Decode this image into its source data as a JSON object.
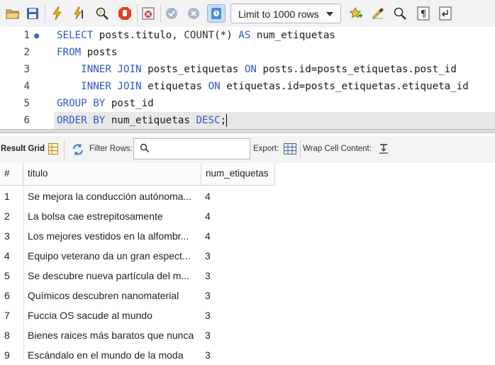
{
  "toolbar": {
    "limit_label": "Limit to 1000 rows",
    "icons": [
      "open-folder-icon",
      "save-icon",
      "execute-lightning-icon",
      "execute-cursor-icon",
      "explain-magnifier-icon",
      "stop-icon",
      "toggle-error-icon",
      "commit-icon",
      "rollback-icon",
      "autocommit-icon",
      "limit-dropdown",
      "add-snippet-icon",
      "beautify-icon",
      "find-icon",
      "invisible-chars-icon",
      "wrap-icon"
    ]
  },
  "editor": {
    "lines": [
      {
        "num": "1",
        "segments": [
          [
            "kw",
            "SELECT "
          ],
          [
            "",
            "posts.titulo, "
          ],
          [
            "fn",
            "COUNT"
          ],
          [
            "",
            "(*) "
          ],
          [
            "kw",
            "AS "
          ],
          [
            "",
            "num_etiquetas"
          ]
        ]
      },
      {
        "num": "2",
        "segments": [
          [
            "kw",
            "FROM "
          ],
          [
            "",
            "posts"
          ]
        ]
      },
      {
        "num": "3",
        "segments": [
          [
            "",
            "    "
          ],
          [
            "kw",
            "INNER JOIN "
          ],
          [
            "",
            "posts_etiquetas "
          ],
          [
            "kw",
            "ON "
          ],
          [
            "",
            "posts.id=posts_etiquetas.post_id"
          ]
        ]
      },
      {
        "num": "4",
        "segments": [
          [
            "",
            "    "
          ],
          [
            "kw",
            "INNER JOIN "
          ],
          [
            "",
            "etiquetas "
          ],
          [
            "kw",
            "ON "
          ],
          [
            "",
            "etiquetas.id=posts_etiquetas.etiqueta_id"
          ]
        ]
      },
      {
        "num": "5",
        "segments": [
          [
            "kw",
            "GROUP BY "
          ],
          [
            "",
            "post_id"
          ]
        ]
      },
      {
        "num": "6",
        "segments": [
          [
            "kw",
            "ORDER BY "
          ],
          [
            "",
            "num_etiquetas "
          ],
          [
            "kw",
            "DESC"
          ],
          [
            "",
            ";"
          ]
        ]
      }
    ]
  },
  "result_bar": {
    "result_grid": "Result Grid",
    "filter_rows": "Filter Rows:",
    "filter_value": "",
    "export": "Export:",
    "wrap": "Wrap Cell Content:"
  },
  "grid": {
    "columns": [
      "#",
      "titulo",
      "num_etiquetas"
    ],
    "rows": [
      [
        "1",
        "Se mejora la conducción autónoma...",
        "4"
      ],
      [
        "2",
        "La bolsa cae estrepitosamente",
        "4"
      ],
      [
        "3",
        "Los mejores vestidos en la alfombr...",
        "4"
      ],
      [
        "4",
        "Equipo veterano da un gran espect...",
        "3"
      ],
      [
        "5",
        "Se descubre nueva partícula del m...",
        "3"
      ],
      [
        "6",
        "Químicos descubren nanomaterial",
        "3"
      ],
      [
        "7",
        "Fuccia OS sacude al mundo",
        "3"
      ],
      [
        "8",
        "Bienes raices más baratos que nunca",
        "3"
      ],
      [
        "9",
        "Escándalo en el mundo de la moda",
        "3"
      ]
    ]
  }
}
